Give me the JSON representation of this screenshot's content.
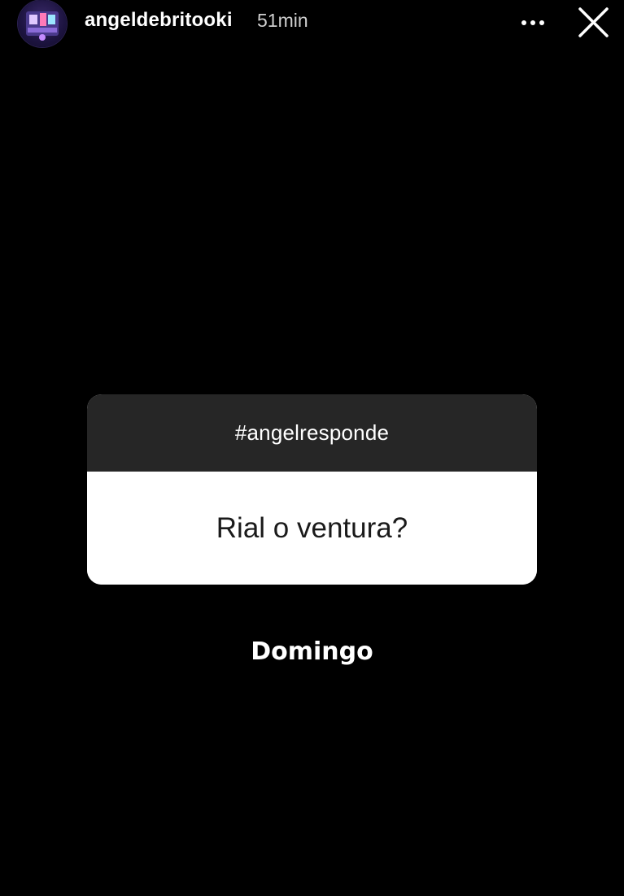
{
  "header": {
    "username": "angeldebritooki",
    "timestamp": "51min",
    "avatar_icon": "profile-avatar",
    "more_icon": "more-options-icon",
    "close_icon": "close-icon"
  },
  "sticker": {
    "prompt": "#angelresponde",
    "question": "Rial o ventura?",
    "header_color": "#262626",
    "body_color": "#ffffff"
  },
  "answer": {
    "text": "Domingo"
  },
  "colors": {
    "background": "#000000",
    "text_primary": "#ffffff",
    "text_secondary": "#cfcfcf"
  }
}
